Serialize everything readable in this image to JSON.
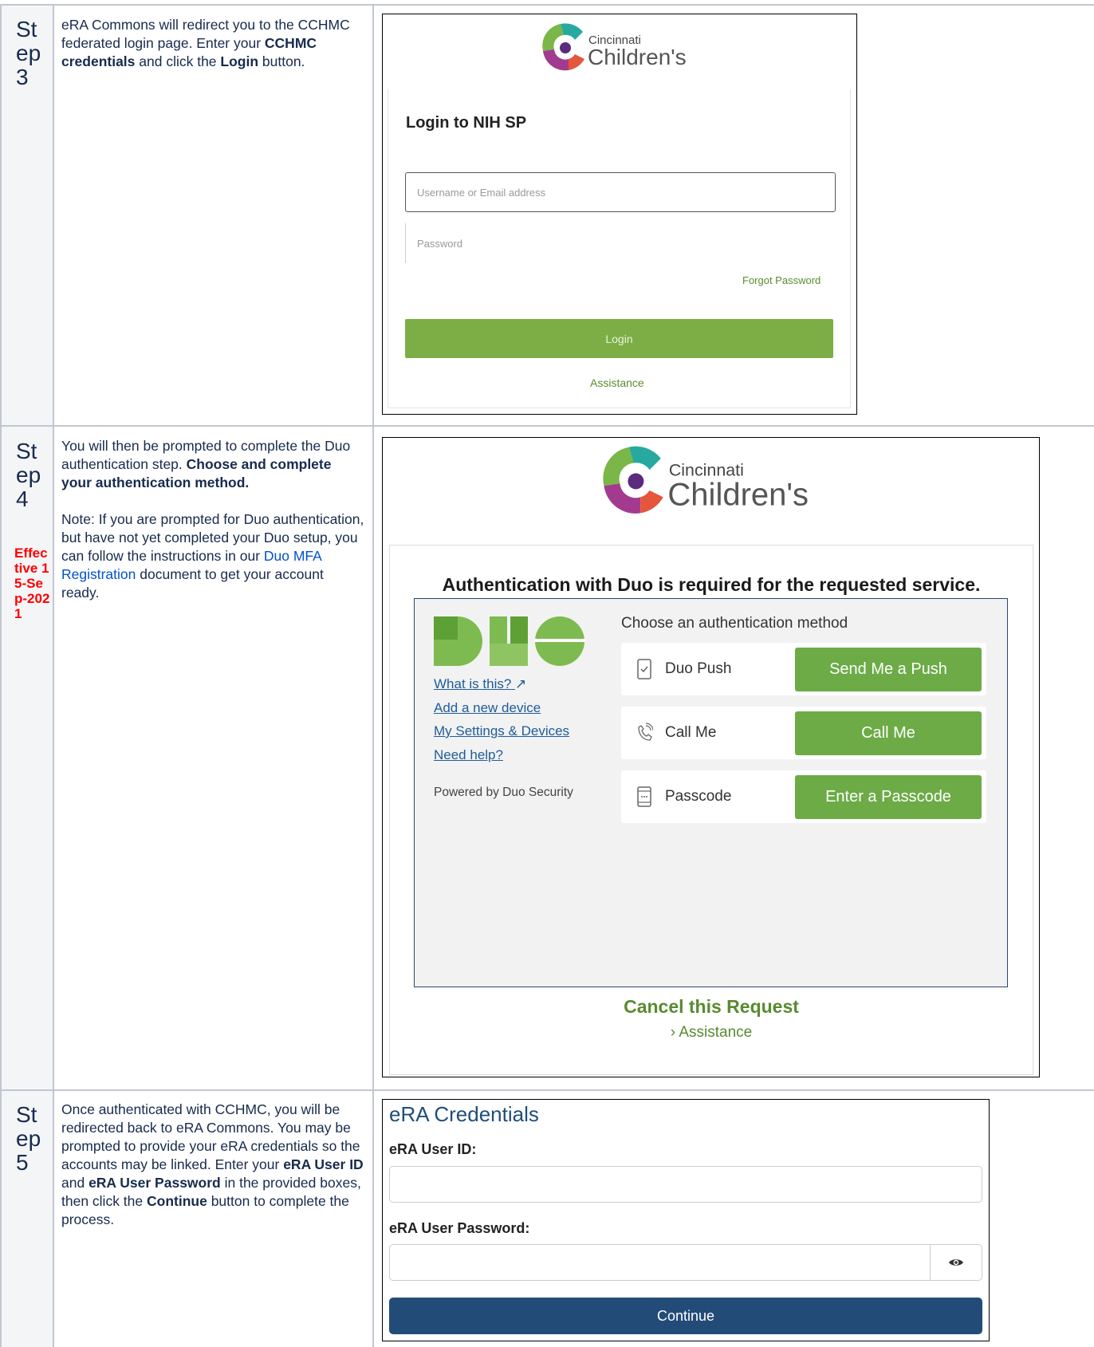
{
  "steps": [
    {
      "label": "Step 3",
      "description": {
        "p1_a": "eRA Commons will redirect you to the CCHMC federated login page. Enter your ",
        "p1_b": "CCHMC credentials",
        "p1_c": " and click the ",
        "p1_d": "Login",
        "p1_e": " button."
      },
      "screenshot": {
        "logo_line1": "Cincinnati",
        "logo_line2": "Children's",
        "title": "Login to NIH SP",
        "username_placeholder": "Username or Email address",
        "password_placeholder": "Password",
        "forgot": "Forgot Password",
        "login_button": "Login",
        "assistance": "Assistance"
      }
    },
    {
      "label": "Step 4",
      "effective": "Effective 15-Sep-2021",
      "description": {
        "p1_a": "You will then be prompted to complete the Duo authentication step. ",
        "p1_b": "Choose and complete your authentication method.",
        "p2_a": "Note: If you are prompted for Duo authentication, but have not yet completed your Duo setup, you can follow the instructions in our ",
        "p2_link": "Duo MFA Registration",
        "p2_b": " document to get your account ready."
      },
      "screenshot": {
        "logo_line1": "Cincinnati",
        "logo_line2": "Children's",
        "heading": "Authentication with Duo is required for the requested service.",
        "links": [
          "What is this?",
          "Add a new device",
          "My Settings & Devices",
          "Need help?"
        ],
        "powered_by": "Powered by Duo Security",
        "choose": "Choose an authentication method",
        "methods": [
          {
            "label": "Duo Push",
            "button": "Send Me a Push",
            "icon": "phone-icon"
          },
          {
            "label": "Call Me",
            "button": "Call Me",
            "icon": "call-icon"
          },
          {
            "label": "Passcode",
            "button": "Enter a Passcode",
            "icon": "passcode-icon"
          }
        ],
        "cancel": "Cancel this Request",
        "assistance": "› Assistance",
        "brand_color": "#6cab46"
      }
    },
    {
      "label": "Step 5",
      "description": {
        "a": "Once authenticated with CCHMC, you will be redirected back to eRA Commons. You may be prompted to provide your eRA credentials so the accounts may be linked. Enter your ",
        "b": "eRA User ID",
        "c": " and ",
        "d": "eRA User Password",
        "e": " in the provided boxes, then click the ",
        "f": "Continue",
        "g": " button to complete the process."
      },
      "screenshot": {
        "title": "eRA Credentials",
        "user_id_label": "eRA User ID:",
        "password_label": "eRA User Password:",
        "continue_button": "Continue"
      }
    }
  ]
}
